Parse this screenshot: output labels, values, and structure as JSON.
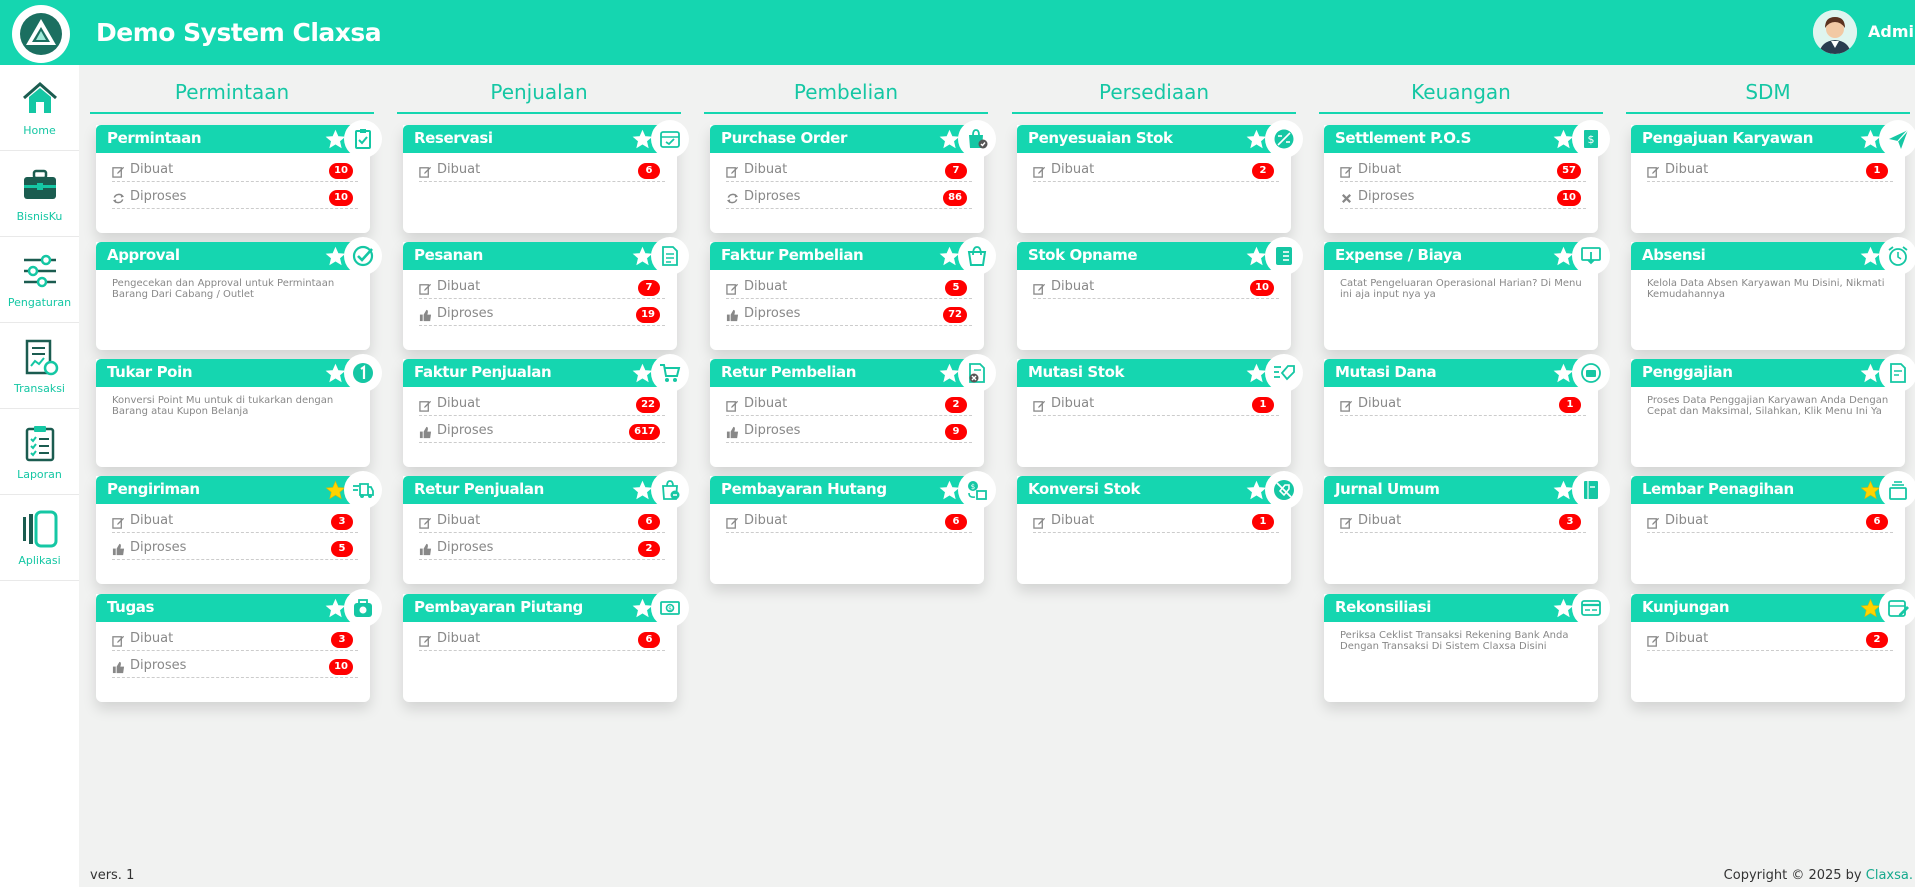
{
  "header": {
    "title": "Demo System Claxsa",
    "user": "Admin"
  },
  "sidebar": {
    "items": [
      {
        "label": "Home",
        "icon": "home-icon"
      },
      {
        "label": "BisnisKu",
        "icon": "briefcase-icon"
      },
      {
        "label": "Pengaturan",
        "icon": "sliders-icon"
      },
      {
        "label": "Transaksi",
        "icon": "receipt-icon"
      },
      {
        "label": "Laporan",
        "icon": "clipboard-list-icon"
      },
      {
        "label": "Aplikasi",
        "icon": "apps-icon"
      }
    ]
  },
  "columns": [
    {
      "title": "Permintaan",
      "cards": [
        {
          "title": "Permintaan",
          "icon": "clipboard-check-icon",
          "favorite": false,
          "rows": [
            {
              "label": "Dibuat",
              "icon": "edit-icon",
              "count": "10"
            },
            {
              "label": "Diproses",
              "icon": "refresh-icon",
              "count": "10"
            }
          ]
        },
        {
          "title": "Approval",
          "icon": "check-circle-icon",
          "favorite": false,
          "description": "Pengecekan dan Approval untuk Permintaan Barang Dari Cabang / Outlet"
        },
        {
          "title": "Tukar Poin",
          "icon": "number-one-icon",
          "favorite": false,
          "description": "Konversi Point Mu untuk di tukarkan dengan Barang atau Kupon Belanja"
        },
        {
          "title": "Pengiriman",
          "icon": "truck-icon",
          "favorite": true,
          "rows": [
            {
              "label": "Dibuat",
              "icon": "edit-icon",
              "count": "3"
            },
            {
              "label": "Diproses",
              "icon": "thumbs-up-icon",
              "count": "5"
            }
          ]
        },
        {
          "title": "Tugas",
          "icon": "camera-bag-icon",
          "favorite": false,
          "rows": [
            {
              "label": "Dibuat",
              "icon": "edit-icon",
              "count": "3"
            },
            {
              "label": "Diproses",
              "icon": "thumbs-up-icon",
              "count": "10"
            }
          ]
        }
      ]
    },
    {
      "title": "Penjualan",
      "cards": [
        {
          "title": "Reservasi",
          "icon": "calendar-check-icon",
          "favorite": false,
          "rows": [
            {
              "label": "Dibuat",
              "icon": "edit-icon",
              "count": "6"
            }
          ]
        },
        {
          "title": "Pesanan",
          "icon": "order-document-icon",
          "favorite": false,
          "rows": [
            {
              "label": "Dibuat",
              "icon": "edit-icon",
              "count": "7"
            },
            {
              "label": "Diproses",
              "icon": "thumbs-up-icon",
              "count": "19"
            }
          ]
        },
        {
          "title": "Faktur Penjualan",
          "icon": "cart-icon",
          "favorite": false,
          "rows": [
            {
              "label": "Dibuat",
              "icon": "edit-icon",
              "count": "22"
            },
            {
              "label": "Diproses",
              "icon": "thumbs-up-icon",
              "count": "617"
            }
          ]
        },
        {
          "title": "Retur Penjualan",
          "icon": "bag-return-icon",
          "favorite": false,
          "rows": [
            {
              "label": "Dibuat",
              "icon": "edit-icon",
              "count": "6"
            },
            {
              "label": "Diproses",
              "icon": "thumbs-up-icon",
              "count": "2"
            }
          ]
        },
        {
          "title": "Pembayaran Piutang",
          "icon": "cash-icon",
          "favorite": false,
          "rows": [
            {
              "label": "Dibuat",
              "icon": "edit-icon",
              "count": "6"
            }
          ]
        }
      ]
    },
    {
      "title": "Pembelian",
      "cards": [
        {
          "title": "Purchase Order",
          "icon": "bag-check-icon",
          "favorite": false,
          "rows": [
            {
              "label": "Dibuat",
              "icon": "edit-icon",
              "count": "7"
            },
            {
              "label": "Diproses",
              "icon": "refresh-icon",
              "count": "86"
            }
          ]
        },
        {
          "title": "Faktur Pembelian",
          "icon": "shopping-bag-icon",
          "favorite": false,
          "rows": [
            {
              "label": "Dibuat",
              "icon": "edit-icon",
              "count": "5"
            },
            {
              "label": "Diproses",
              "icon": "thumbs-up-icon",
              "count": "72"
            }
          ]
        },
        {
          "title": "Retur Pembelian",
          "icon": "file-cancel-icon",
          "favorite": false,
          "rows": [
            {
              "label": "Dibuat",
              "icon": "edit-icon",
              "count": "2"
            },
            {
              "label": "Diproses",
              "icon": "thumbs-up-icon",
              "count": "9"
            }
          ]
        },
        {
          "title": "Pembayaran Hutang",
          "icon": "money-transfer-icon",
          "favorite": false,
          "rows": [
            {
              "label": "Dibuat",
              "icon": "edit-icon",
              "count": "6"
            }
          ]
        }
      ]
    },
    {
      "title": "Persediaan",
      "cards": [
        {
          "title": "Penyesuaian Stok",
          "icon": "adjust-icon",
          "favorite": false,
          "rows": [
            {
              "label": "Dibuat",
              "icon": "edit-icon",
              "count": "2"
            }
          ]
        },
        {
          "title": "Stok Opname",
          "icon": "list-doc-icon",
          "favorite": false,
          "rows": [
            {
              "label": "Dibuat",
              "icon": "edit-icon",
              "count": "10"
            }
          ]
        },
        {
          "title": "Mutasi Stok",
          "icon": "tag-list-icon",
          "favorite": false,
          "rows": [
            {
              "label": "Dibuat",
              "icon": "edit-icon",
              "count": "1"
            }
          ]
        },
        {
          "title": "Konversi Stok",
          "icon": "no-tag-icon",
          "favorite": false,
          "rows": [
            {
              "label": "Dibuat",
              "icon": "edit-icon",
              "count": "1"
            }
          ]
        }
      ]
    },
    {
      "title": "Keuangan",
      "cards": [
        {
          "title": "Settlement P.O.S",
          "icon": "dollar-doc-icon",
          "favorite": false,
          "rows": [
            {
              "label": "Dibuat",
              "icon": "edit-icon",
              "count": "57"
            },
            {
              "label": "Diproses",
              "icon": "times-icon",
              "count": "10"
            }
          ]
        },
        {
          "title": "Expense / Biaya",
          "icon": "monitor-download-icon",
          "favorite": false,
          "description": "Catat Pengeluaran Operasional Harian? Di Menu ini aja input nya ya"
        },
        {
          "title": "Mutasi Dana",
          "icon": "wallet-cycle-icon",
          "favorite": false,
          "rows": [
            {
              "label": "Dibuat",
              "icon": "edit-icon",
              "count": "1"
            }
          ]
        },
        {
          "title": "Jurnal Umum",
          "icon": "journal-book-icon",
          "favorite": false,
          "rows": [
            {
              "label": "Dibuat",
              "icon": "edit-icon",
              "count": "3"
            }
          ]
        },
        {
          "title": "Rekonsiliasi",
          "icon": "bank-card-icon",
          "favorite": false,
          "description": "Periksa Ceklist Transaksi Rekening Bank Anda Dengan Transaksi Di Sistem Claxsa Disini"
        }
      ]
    },
    {
      "title": "SDM",
      "cards": [
        {
          "title": "Pengajuan Karyawan",
          "icon": "send-icon",
          "favorite": false,
          "rows": [
            {
              "label": "Dibuat",
              "icon": "edit-icon",
              "count": "1"
            }
          ]
        },
        {
          "title": "Absensi",
          "icon": "alarm-clock-icon",
          "favorite": false,
          "description": "Kelola Data Absen Karyawan Mu Disini, Nikmati Kemudahannya"
        },
        {
          "title": "Penggajian",
          "icon": "payroll-doc-icon",
          "favorite": false,
          "description": "Proses Data Penggajian Karyawan Anda Dengan Cepat dan Maksimal, Silahkan, Klik Menu Ini Ya"
        },
        {
          "title": "Lembar Penagihan",
          "icon": "invoice-stack-icon",
          "favorite": true,
          "rows": [
            {
              "label": "Dibuat",
              "icon": "edit-icon",
              "count": "6"
            }
          ]
        },
        {
          "title": "Kunjungan",
          "icon": "calendar-edit-icon",
          "favorite": true,
          "rows": [
            {
              "label": "Dibuat",
              "icon": "edit-icon",
              "count": "2"
            }
          ]
        }
      ]
    }
  ],
  "footer": {
    "version": "vers. 1",
    "copyright": "Copyright © 2025 by",
    "brand": "Claxsa."
  },
  "colors": {
    "accent": "#15d6b0",
    "badge": "#ff0000",
    "star_active": "#ffd400",
    "star_inactive": "#ffffff"
  }
}
